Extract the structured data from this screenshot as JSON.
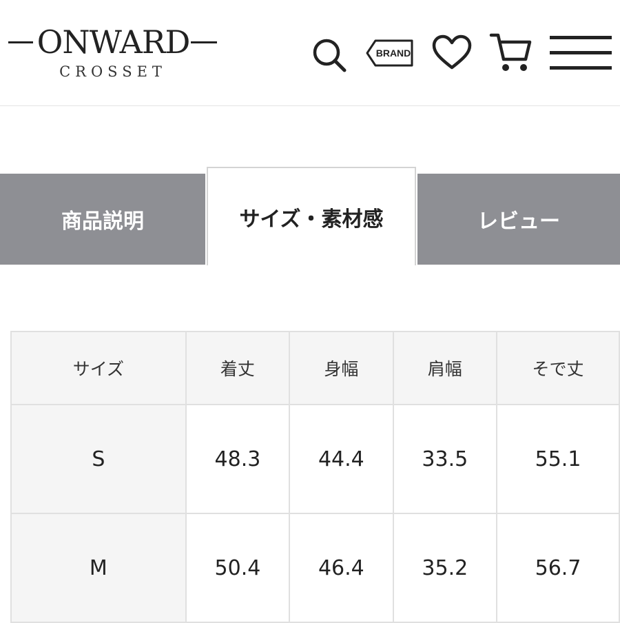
{
  "brand": {
    "name": "ONWARD",
    "sub": "CROSSET"
  },
  "header_icons": {
    "search": "search-icon",
    "brand_tag": {
      "icon": "brand-tag-icon",
      "label": "BRAND"
    },
    "favorite": "heart-icon",
    "cart": "cart-icon",
    "menu": "hamburger-menu-icon"
  },
  "tabs": [
    {
      "label": "商品説明",
      "active": false
    },
    {
      "label": "サイズ・素材感",
      "active": true
    },
    {
      "label": "レビュー",
      "active": false
    }
  ],
  "colors": {
    "inactive_tab": "#8e8f94",
    "table_border": "#e0e0e0",
    "header_cell": "#f5f5f5"
  },
  "size_table": {
    "headers": [
      "サイズ",
      "着丈",
      "身幅",
      "肩幅",
      "そで丈"
    ],
    "rows": [
      [
        "S",
        "48.3",
        "44.4",
        "33.5",
        "55.1"
      ],
      [
        "M",
        "50.4",
        "46.4",
        "35.2",
        "56.7"
      ]
    ]
  }
}
